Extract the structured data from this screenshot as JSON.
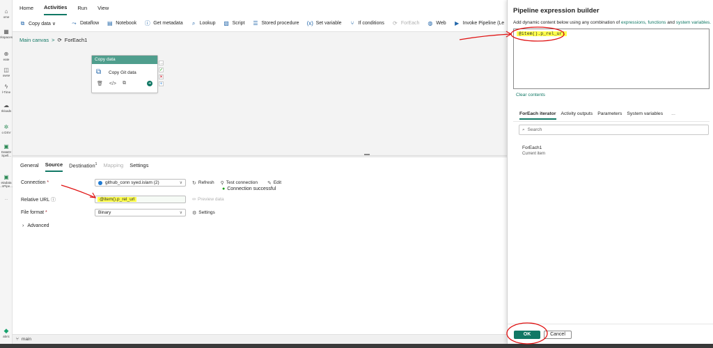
{
  "rail": {
    "items": [
      {
        "label": "ome",
        "icon": "home-icon",
        "glyph": "⌂"
      },
      {
        "label": "rkspaces",
        "icon": "workspaces-icon",
        "glyph": "▦"
      },
      {
        "label": "eate",
        "icon": "create-icon",
        "glyph": "⊕"
      },
      {
        "label": "owse",
        "icon": "browse-icon",
        "glyph": "◫"
      },
      {
        "label": "l-Time",
        "icon": "realtime-icon",
        "glyph": "ϟ"
      },
      {
        "label": "rkloads",
        "icon": "workloads-icon",
        "glyph": "☁"
      },
      {
        "label": "o DSV",
        "icon": "dsv-icon",
        "glyph": "✲"
      },
      {
        "label": "DataDr Spell...",
        "icon": "datadr-icon",
        "glyph": "▣"
      },
      {
        "label": "etadata ..nPipe...",
        "icon": "metadata-icon",
        "glyph": "▣"
      },
      {
        "label": "...",
        "icon": "more-icon",
        "glyph": ""
      }
    ],
    "fabric": {
      "label": "abric",
      "icon": "fabric-icon",
      "glyph": "◆"
    }
  },
  "menubar": {
    "tabs": [
      {
        "label": "Home",
        "active": false
      },
      {
        "label": "Activities",
        "active": true
      },
      {
        "label": "Run",
        "active": false
      },
      {
        "label": "View",
        "active": false
      }
    ]
  },
  "ribbon": {
    "items": [
      {
        "label": "Copy data ∨",
        "icon": "copy-data-icon",
        "glyph": "⧉",
        "disabled": false
      },
      {
        "label": "Dataflow",
        "icon": "dataflow-icon",
        "glyph": "⤳",
        "disabled": false
      },
      {
        "label": "Notebook",
        "icon": "notebook-icon",
        "glyph": "▤",
        "disabled": false
      },
      {
        "label": "Get metadata",
        "icon": "info-icon",
        "glyph": "ⓘ",
        "disabled": false
      },
      {
        "label": "Lookup",
        "icon": "lookup-icon",
        "glyph": "⌕",
        "disabled": false
      },
      {
        "label": "Script",
        "icon": "script-icon",
        "glyph": "▧",
        "disabled": false
      },
      {
        "label": "Stored procedure",
        "icon": "stored-procedure-icon",
        "glyph": "☰",
        "disabled": false
      },
      {
        "label": "Set variable",
        "icon": "variable-icon",
        "glyph": "(x)",
        "disabled": false
      },
      {
        "label": "If conditions",
        "icon": "if-condition-icon",
        "glyph": "⑂",
        "disabled": false
      },
      {
        "label": "ForEach",
        "icon": "foreach-icon",
        "glyph": "⟳",
        "disabled": true
      },
      {
        "label": "Web",
        "icon": "web-icon",
        "glyph": "◍",
        "disabled": false
      },
      {
        "label": "Invoke Pipeline (Le",
        "icon": "invoke-pipeline-icon",
        "glyph": "▶",
        "disabled": false
      }
    ]
  },
  "canvas": {
    "breadcrumb": {
      "root": "Main canvas",
      "sep": ">",
      "current": "ForEach1",
      "current_icon_glyph": "⟳"
    },
    "activity": {
      "header": "Copy data",
      "name": "Copy Git data",
      "icon_glyph": "⧉",
      "tools": [
        "🗑",
        "</>",
        "⧉"
      ],
      "run_glyph": "➜",
      "side": [
        "→",
        "✓",
        "✕",
        "+"
      ]
    }
  },
  "props": {
    "tabs": [
      {
        "label": "General",
        "active": false,
        "disabled": false,
        "sup": ""
      },
      {
        "label": "Source",
        "active": true,
        "disabled": false,
        "sup": ""
      },
      {
        "label": "Destination",
        "active": false,
        "disabled": false,
        "sup": "1"
      },
      {
        "label": "Mapping",
        "active": false,
        "disabled": true,
        "sup": ""
      },
      {
        "label": "Settings",
        "active": false,
        "disabled": false,
        "sup": ""
      }
    ],
    "connection": {
      "label": "Connection",
      "required": "*",
      "value": "github_conn syed.islam (2)",
      "refresh": "Refresh",
      "test": "Test connection",
      "edit": "Edit",
      "status": "Connection successful"
    },
    "relative_url": {
      "label": "Relative URL",
      "value": "@item().p_rel_url",
      "preview": "Preview data"
    },
    "file_format": {
      "label": "File format",
      "required": "*",
      "value": "Binary",
      "settings": "Settings"
    },
    "advanced": "Advanced"
  },
  "statusbar": {
    "branch": "main"
  },
  "panel": {
    "title": "Pipeline expression builder",
    "subtitle_prefix": "Add dynamic content below using any combination of",
    "link_expressions": "expressions,",
    "link_functions": "functions",
    "and": "and",
    "link_system_variables": "system variables.",
    "expression": "@item().p_rel_url",
    "clear": "Clear contents",
    "tabs": [
      {
        "label": "ForEach iterator",
        "active": true
      },
      {
        "label": "Activity outputs",
        "active": false
      },
      {
        "label": "Parameters",
        "active": false
      },
      {
        "label": "System variables",
        "active": false
      }
    ],
    "tabs_more": "...",
    "search_placeholder": "Search",
    "item": {
      "name": "ForEach1",
      "desc": "Current item"
    },
    "ok": "OK",
    "cancel": "Cancel"
  }
}
